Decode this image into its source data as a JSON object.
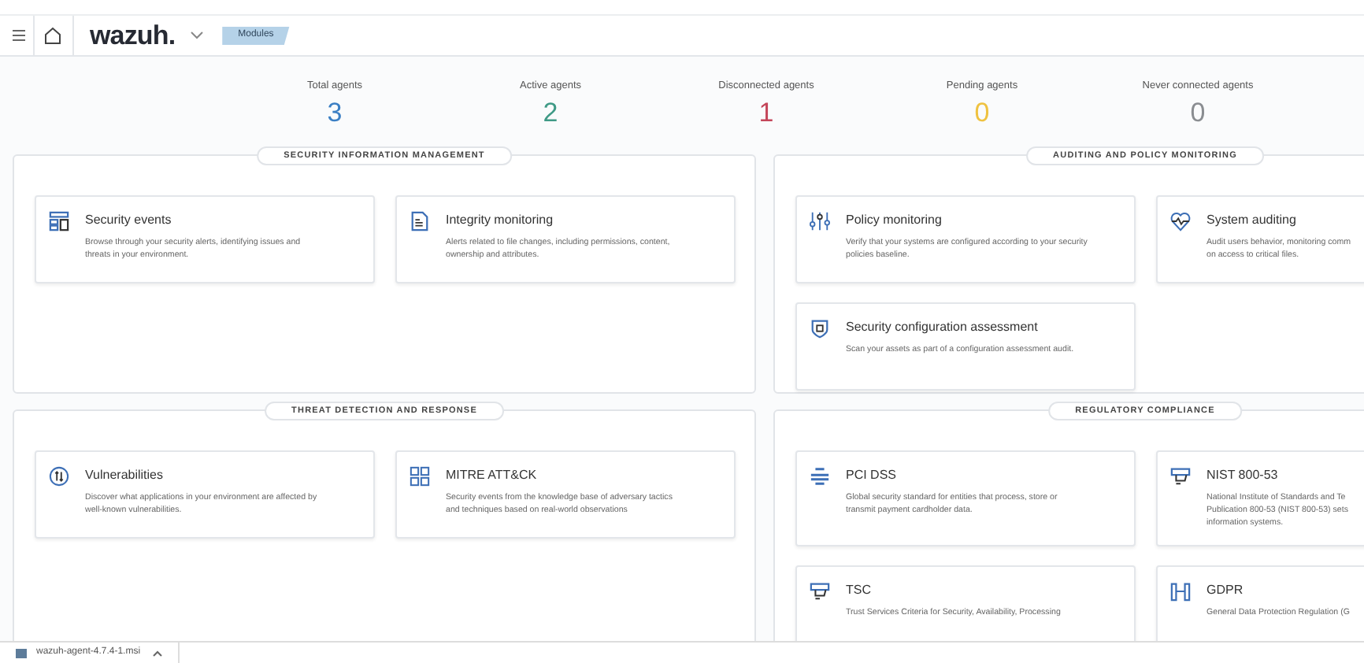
{
  "header": {
    "logo": "wazuh.",
    "breadcrumb": "Modules"
  },
  "stats": [
    {
      "label": "Total agents",
      "value": "3",
      "color": "#3b7fc4"
    },
    {
      "label": "Active agents",
      "value": "2",
      "color": "#3f9a86"
    },
    {
      "label": "Disconnected agents",
      "value": "1",
      "color": "#c4465a"
    },
    {
      "label": "Pending agents",
      "value": "0",
      "color": "#efc241"
    },
    {
      "label": "Never connected agents",
      "value": "0",
      "color": "#8a8d91"
    }
  ],
  "sections": [
    {
      "title": "SECURITY INFORMATION MANAGEMENT",
      "cards": [
        {
          "title": "Security events",
          "lines": [
            "Browse through your security alerts, identifying issues and",
            "threats in your environment."
          ]
        },
        {
          "title": "Integrity monitoring",
          "lines": [
            "Alerts related to file changes, including permissions, content,",
            "ownership and attributes."
          ]
        }
      ]
    },
    {
      "title": "AUDITING AND POLICY MONITORING",
      "cards": [
        {
          "title": "Policy monitoring",
          "lines": [
            "Verify that your systems are configured according to your security",
            "policies baseline."
          ]
        },
        {
          "title": "System auditing",
          "lines": [
            "Audit users behavior, monitoring comm",
            "on access to critical files."
          ]
        },
        {
          "title": "Security configuration assessment",
          "lines": [
            "Scan your assets as part of a configuration assessment audit."
          ]
        }
      ]
    },
    {
      "title": "THREAT DETECTION AND RESPONSE",
      "cards": [
        {
          "title": "Vulnerabilities",
          "lines": [
            "Discover what applications in your environment are affected by",
            "well-known vulnerabilities."
          ]
        },
        {
          "title": "MITRE ATT&CK",
          "lines": [
            "Security events from the knowledge base of adversary tactics",
            "and techniques based on real-world observations"
          ]
        }
      ]
    },
    {
      "title": "REGULATORY COMPLIANCE",
      "cards": [
        {
          "title": "PCI DSS",
          "lines": [
            "Global security standard for entities that process, store or",
            "transmit payment cardholder data."
          ]
        },
        {
          "title": "NIST 800-53",
          "lines": [
            "National Institute of Standards and Te",
            "Publication 800-53 (NIST 800-53) sets",
            "information systems."
          ]
        },
        {
          "title": "TSC",
          "lines": [
            "Trust Services Criteria for Security, Availability, Processing"
          ]
        },
        {
          "title": "GDPR",
          "lines": [
            "General Data Protection Regulation (G"
          ]
        }
      ]
    }
  ],
  "download": {
    "file": "wazuh-agent-4.7.4-1.msi"
  }
}
